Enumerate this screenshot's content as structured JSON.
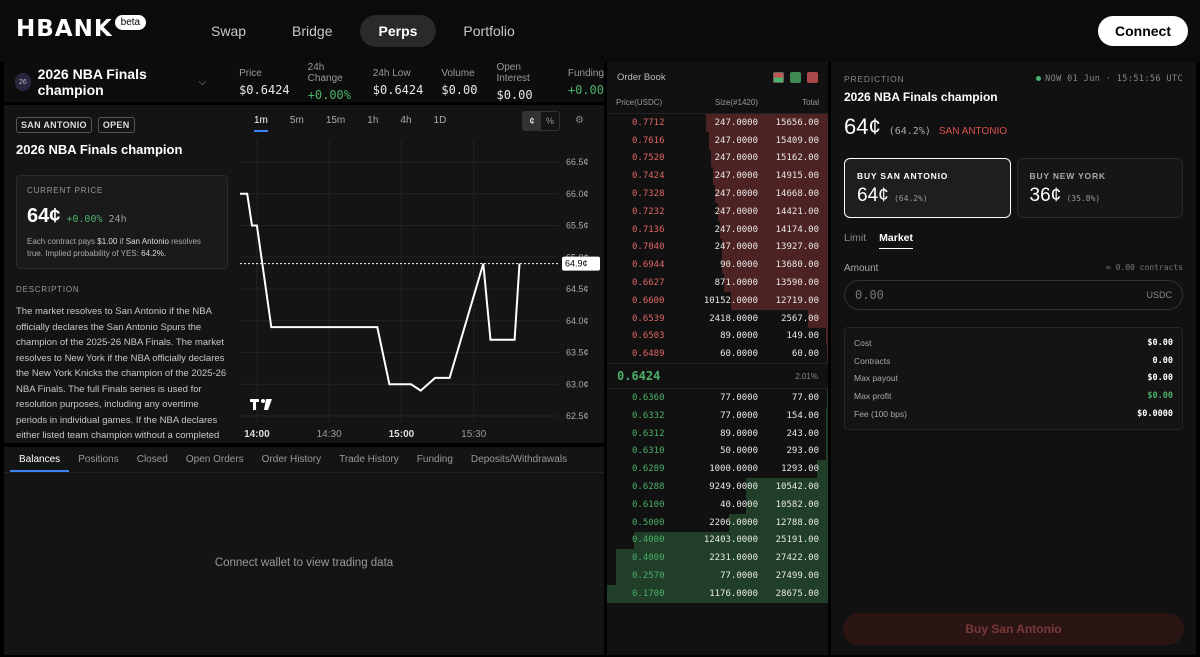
{
  "logo": {
    "text": "HBANK",
    "beta": "beta"
  },
  "nav": {
    "items": [
      "Swap",
      "Bridge",
      "Perps",
      "Portfolio"
    ],
    "active": "Perps"
  },
  "connect_label": "Connect",
  "market": {
    "icon_text": "26",
    "title": "2026 NBA Finals champion",
    "stats": [
      {
        "label": "Price",
        "value": "$0.6424"
      },
      {
        "label": "24h Change",
        "value": "+0.00%"
      },
      {
        "label": "24h Low",
        "value": "$0.6424"
      },
      {
        "label": "Volume",
        "value": "$0.00"
      },
      {
        "label": "Open Interest",
        "value": "$0.00"
      },
      {
        "label": "Funding",
        "value": "+0.00"
      }
    ]
  },
  "info": {
    "badges": [
      "SAN ANTONIO",
      "OPEN"
    ],
    "title": "2026 NBA Finals champion",
    "current_price_label": "CURRENT PRICE",
    "current_price": "64¢",
    "change": "+0.00%",
    "change_period": "24h",
    "note_a": "Each contract pays ",
    "note_pay": "$1.00",
    "note_b": " if ",
    "note_team": "San Antonio",
    "note_c": " resolves true. Implied probability of YES: ",
    "note_prob": "64.2%.",
    "description_label": "DESCRIPTION",
    "description": "The market resolves to San Antonio if the NBA officially declares the San Antonio Spurs the champion of the 2025-26 NBA Finals. The market resolves to New York if the NBA officially declares the New York Knicks the champion of the 2025-26 NBA Finals. The full Finals series is used for resolution purposes, including any overtime periods in individual games. If the NBA declares either listed team champion without a completed Finals series, the market resolves to that team."
  },
  "chart": {
    "timeframes": [
      "1m",
      "5m",
      "15m",
      "1h",
      "4h",
      "1D"
    ],
    "active_timeframe": "1m",
    "units": [
      "¢",
      "%"
    ],
    "active_unit": "¢",
    "settings_icon": "settings-icon",
    "current_label": "64.9¢"
  },
  "chart_data": {
    "type": "line",
    "x": [
      "13:53",
      "13:56",
      "13:58",
      "14:00",
      "14:06",
      "14:12",
      "14:18",
      "14:26",
      "14:34",
      "14:42",
      "14:50",
      "14:55",
      "15:04",
      "15:08",
      "15:11",
      "15:14",
      "15:20",
      "15:34",
      "15:37",
      "15:47",
      "15:49"
    ],
    "y": [
      66.0,
      66.0,
      65.5,
      65.5,
      63.9,
      63.9,
      63.9,
      63.9,
      63.9,
      63.9,
      63.9,
      63.0,
      63.0,
      62.9,
      63.0,
      63.1,
      63.1,
      64.9,
      63.7,
      63.7,
      64.9
    ],
    "xticks": [
      "14:00",
      "14:30",
      "15:00",
      "15:30"
    ],
    "yticks": [
      "66.5¢",
      "66.0¢",
      "65.5¢",
      "65.0¢",
      "64.5¢",
      "64.0¢",
      "63.5¢",
      "63.0¢",
      "62.5¢"
    ],
    "ylim": [
      62.5,
      66.5
    ],
    "last_value": 64.9,
    "unit": "¢",
    "grid": true
  },
  "bottom": {
    "tabs": [
      "Balances",
      "Positions",
      "Closed",
      "Open Orders",
      "Order History",
      "Trade History",
      "Funding",
      "Deposits/Withdrawals"
    ],
    "active_tab": "Balances",
    "empty_message": "Connect wallet to view trading data"
  },
  "orderbook": {
    "title": "Order Book",
    "columns": [
      "Price(USDC)",
      "Size(#1420)",
      "Total"
    ],
    "asks": [
      {
        "price": "0.7712",
        "size": "247.0000",
        "total": "15656.00",
        "depth": 0.55
      },
      {
        "price": "0.7616",
        "size": "247.0000",
        "total": "15409.00",
        "depth": 0.54
      },
      {
        "price": "0.7520",
        "size": "247.0000",
        "total": "15162.00",
        "depth": 0.53
      },
      {
        "price": "0.7424",
        "size": "247.0000",
        "total": "14915.00",
        "depth": 0.52
      },
      {
        "price": "0.7328",
        "size": "247.0000",
        "total": "14668.00",
        "depth": 0.51
      },
      {
        "price": "0.7232",
        "size": "247.0000",
        "total": "14421.00",
        "depth": 0.5
      },
      {
        "price": "0.7136",
        "size": "247.0000",
        "total": "14174.00",
        "depth": 0.49
      },
      {
        "price": "0.7040",
        "size": "247.0000",
        "total": "13927.00",
        "depth": 0.48
      },
      {
        "price": "0.6944",
        "size": "90.0000",
        "total": "13680.00",
        "depth": 0.48
      },
      {
        "price": "0.6627",
        "size": "871.0000",
        "total": "13590.00",
        "depth": 0.47
      },
      {
        "price": "0.6600",
        "size": "10152.0000",
        "total": "12719.00",
        "depth": 0.44
      },
      {
        "price": "0.6539",
        "size": "2418.0000",
        "total": "2567.00",
        "depth": 0.09
      },
      {
        "price": "0.6503",
        "size": "89.0000",
        "total": "149.00",
        "depth": 0.01
      },
      {
        "price": "0.6489",
        "size": "60.0000",
        "total": "60.00",
        "depth": 0.005
      }
    ],
    "mid_price": "0.6424",
    "spread": "2.01%",
    "bids": [
      {
        "price": "0.6360",
        "size": "77.0000",
        "total": "77.00",
        "depth": 0.005
      },
      {
        "price": "0.6332",
        "size": "77.0000",
        "total": "154.00",
        "depth": 0.01
      },
      {
        "price": "0.6312",
        "size": "89.0000",
        "total": "243.00",
        "depth": 0.01
      },
      {
        "price": "0.6310",
        "size": "50.0000",
        "total": "293.00",
        "depth": 0.01
      },
      {
        "price": "0.6289",
        "size": "1000.0000",
        "total": "1293.00",
        "depth": 0.05
      },
      {
        "price": "0.6288",
        "size": "9249.0000",
        "total": "10542.00",
        "depth": 0.37
      },
      {
        "price": "0.6100",
        "size": "40.0000",
        "total": "10582.00",
        "depth": 0.37
      },
      {
        "price": "0.5000",
        "size": "2206.0000",
        "total": "12788.00",
        "depth": 0.45
      },
      {
        "price": "0.4000",
        "size": "12403.0000",
        "total": "25191.00",
        "depth": 0.88
      },
      {
        "price": "0.4000",
        "size": "2231.0000",
        "total": "27422.00",
        "depth": 0.96
      },
      {
        "price": "0.2570",
        "size": "77.0000",
        "total": "27499.00",
        "depth": 0.96
      },
      {
        "price": "0.1700",
        "size": "1176.0000",
        "total": "28675.00",
        "depth": 1.0
      }
    ]
  },
  "trade": {
    "label": "PREDICTION",
    "time": "NOW 01 Jun · 15:51:56 UTC",
    "title": "2026 NBA Finals champion",
    "price": "64¢",
    "pct": "(64.2%)",
    "team": "SAN ANTONIO",
    "outcomes": [
      {
        "label": "BUY SAN ANTONIO",
        "price": "64¢",
        "pct": "(64.2%)"
      },
      {
        "label": "BUY NEW YORK",
        "price": "36¢",
        "pct": "(35.8%)"
      }
    ],
    "order_tabs": [
      "Limit",
      "Market"
    ],
    "active_order_tab": "Market",
    "amount_label": "Amount",
    "approx_contracts": "≈ 0.00 contracts",
    "amount_placeholder": "0.00",
    "amount_unit": "USDC",
    "summary": [
      {
        "label": "Cost",
        "value": "$0.00",
        "green": false
      },
      {
        "label": "Contracts",
        "value": "0.00",
        "green": false
      },
      {
        "label": "Max payout",
        "value": "$0.00",
        "green": false
      },
      {
        "label": "Max profit",
        "value": "$0.00",
        "green": true
      },
      {
        "label": "Fee (100 bps)",
        "value": "$0.0000",
        "green": false
      }
    ],
    "buy_label": "Buy San Antonio"
  },
  "colors": {
    "green": "#4caf6a",
    "red": "#e06565",
    "accent": "#3b82f6"
  }
}
